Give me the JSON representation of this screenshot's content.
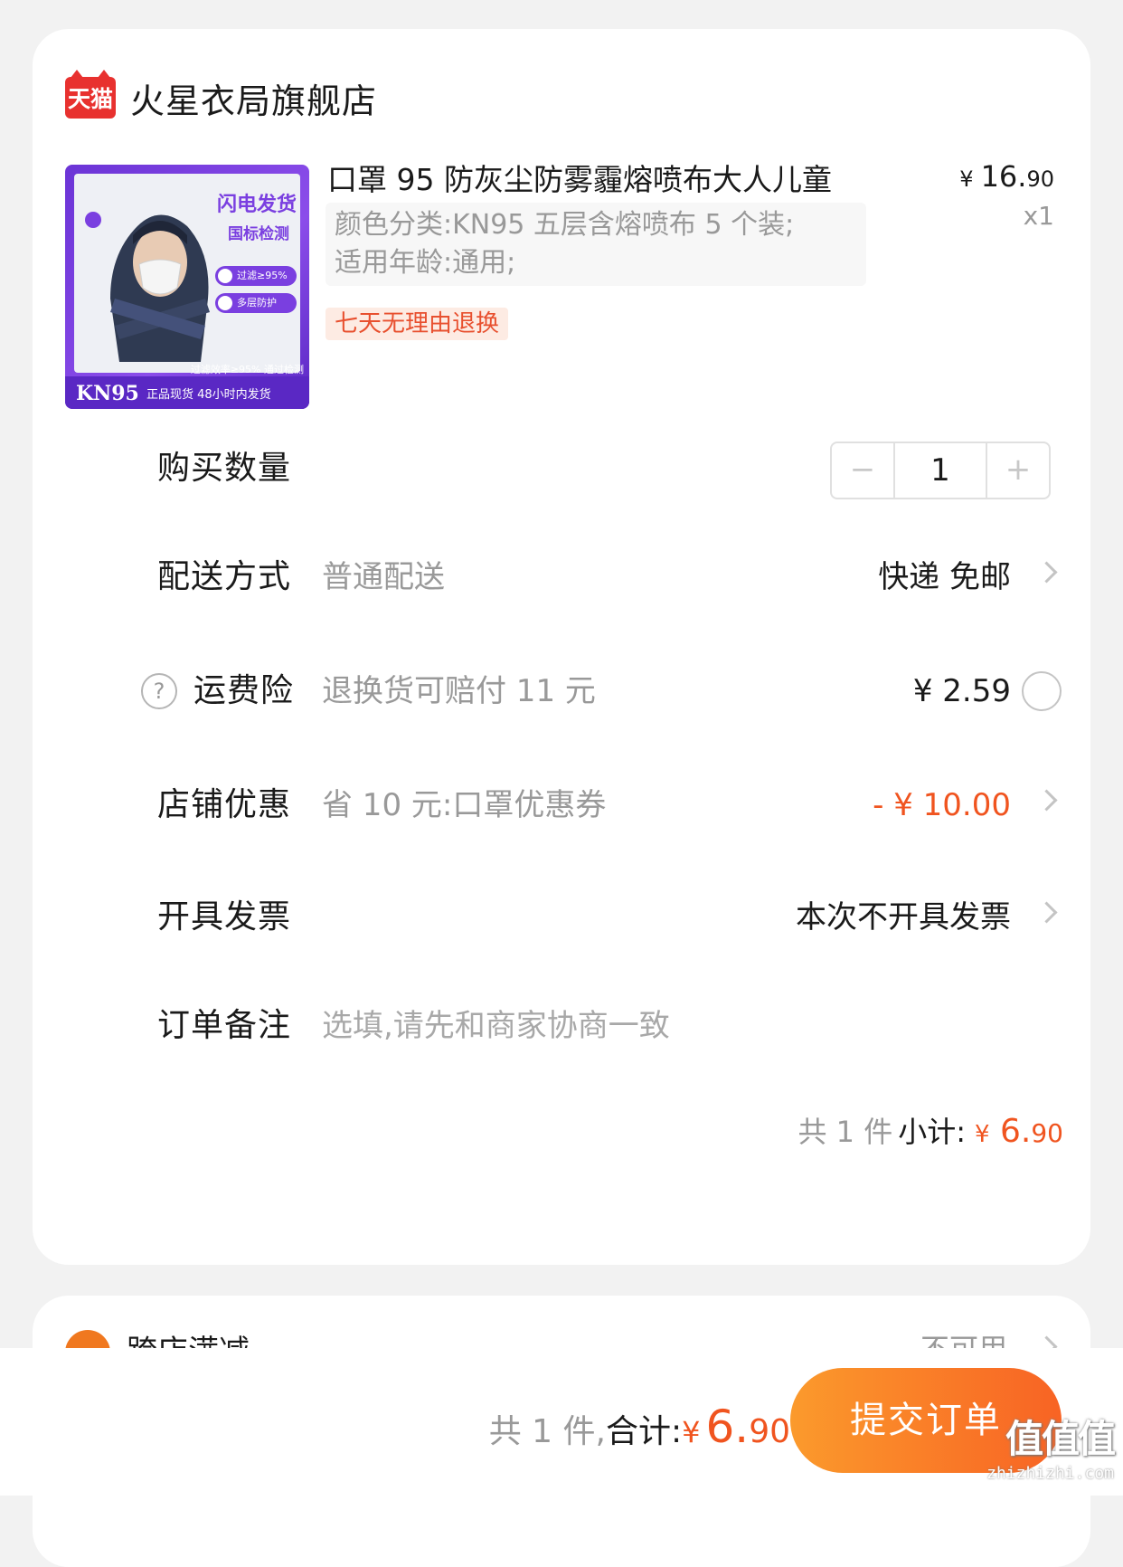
{
  "store": {
    "badge": "天猫",
    "name": "火星衣局旗舰店"
  },
  "product": {
    "image": {
      "badge_top": "闪电发货",
      "badge_sub": "国标检测",
      "pill1": "过滤≥95%",
      "pill2": "多层防护",
      "footer_line": "过滤效率≥95%  通过检测",
      "kn": "KN95",
      "footer_text": "正品现货 48小时内发货"
    },
    "title": "口罩 95 防灰尘防雾霾熔喷布大人儿童",
    "price_currency": "¥",
    "price_int": "16.",
    "price_dec": "90",
    "quantity_mark": "x1",
    "sku_line1": "颜色分类:KN95 五层含熔喷布 5 个装;",
    "sku_line2": "适用年龄:通用;",
    "tag": "七天无理由退换"
  },
  "quantity": {
    "label": "购买数量",
    "minus": "−",
    "value": "1",
    "plus": "+"
  },
  "delivery": {
    "label": "配送方式",
    "sub": "普通配送",
    "value": "快递 免邮"
  },
  "insurance": {
    "help_icon": "?",
    "label": "运费险",
    "sub": "退换货可赔付 11 元",
    "value": "¥ 2.59"
  },
  "discount": {
    "label": "店铺优惠",
    "sub": "省 10 元:口罩优惠券",
    "value": "- ¥ 10.00",
    "color": "#f0541f"
  },
  "invoice": {
    "label": "开具发票",
    "value": "本次不开具发票"
  },
  "note": {
    "label": "订单备注",
    "placeholder": "选填,请先和商家协商一致"
  },
  "subtotal": {
    "count": "共 1 件",
    "label": "小计:",
    "currency": "¥",
    "int": "6.",
    "dec": "90"
  },
  "cross_store": {
    "label": "跨店满减",
    "value": "不可用"
  },
  "bottom": {
    "count": "共 1 件,",
    "label": "合计:",
    "currency": "¥",
    "int": "6.",
    "dec": "90",
    "submit": "提交订单",
    "accent": "#f86324"
  },
  "watermark": {
    "logo": "值值值",
    "url": "zhizhizhi.com"
  }
}
